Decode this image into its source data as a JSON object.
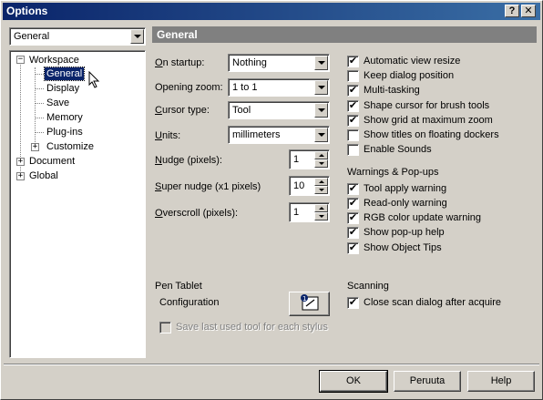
{
  "window": {
    "title": "Options"
  },
  "titlebar_buttons": {
    "help": "?",
    "close": "✕"
  },
  "category_dropdown": {
    "value": "General"
  },
  "tree": {
    "items": [
      {
        "label": "Workspace",
        "expander": "−"
      },
      {
        "label": "General"
      },
      {
        "label": "Display"
      },
      {
        "label": "Save"
      },
      {
        "label": "Memory"
      },
      {
        "label": "Plug-ins"
      },
      {
        "label": "Customize",
        "expander": "+"
      },
      {
        "label": "Document",
        "expander": "+"
      },
      {
        "label": "Global",
        "expander": "+"
      }
    ]
  },
  "panel": {
    "title": "General"
  },
  "fields": {
    "on_startup": {
      "label_u": "O",
      "label_rest": "n startup:",
      "value": "Nothing"
    },
    "opening_zoom": {
      "label_pre": "Opening zoom:",
      "value": "1 to 1"
    },
    "cursor_type": {
      "label_u": "C",
      "label_rest": "ursor type:",
      "value": "Tool"
    },
    "units": {
      "label_u": "U",
      "label_rest": "nits:",
      "value": "millimeters"
    },
    "nudge": {
      "label_u": "N",
      "label_rest": "udge (pixels):",
      "value": "1"
    },
    "super_nudge": {
      "label_u": "S",
      "label_rest": "uper nudge (x1 pixels)",
      "value": "10"
    },
    "overscroll": {
      "label_u": "O",
      "label_rest": "verscroll (pixels):",
      "value": "1"
    }
  },
  "options": [
    {
      "label": "Automatic view resize",
      "checked": "✔"
    },
    {
      "label": "Keep dialog position",
      "checked": ""
    },
    {
      "label": "Multi-tasking",
      "checked": "✔"
    },
    {
      "label": "Shape cursor for brush tools",
      "checked": "✔"
    },
    {
      "label": "Show grid at maximum zoom",
      "checked": "✔"
    },
    {
      "label": "Show titles on floating dockers",
      "checked": ""
    },
    {
      "label": "Enable Sounds",
      "checked": ""
    }
  ],
  "warnings": {
    "heading": "Warnings & Pop-ups",
    "items": [
      {
        "label": "Tool apply warning",
        "checked": "✔"
      },
      {
        "label": "Read-only warning",
        "checked": "✔"
      },
      {
        "label": "RGB color update warning",
        "checked": "✔"
      },
      {
        "label": "Show pop-up help",
        "checked": "✔"
      },
      {
        "label": "Show Object Tips",
        "checked": "✔"
      }
    ]
  },
  "pen_tablet": {
    "heading": "Pen Tablet",
    "configuration_label": "Configuration",
    "save_stylus_label": "Save last used tool for each stylus"
  },
  "scanning": {
    "heading": "Scanning",
    "close_scan_label": "Close scan dialog after acquire",
    "checked": "✔"
  },
  "buttons": {
    "ok": "OK",
    "cancel": "Peruuta",
    "help": "Help"
  }
}
